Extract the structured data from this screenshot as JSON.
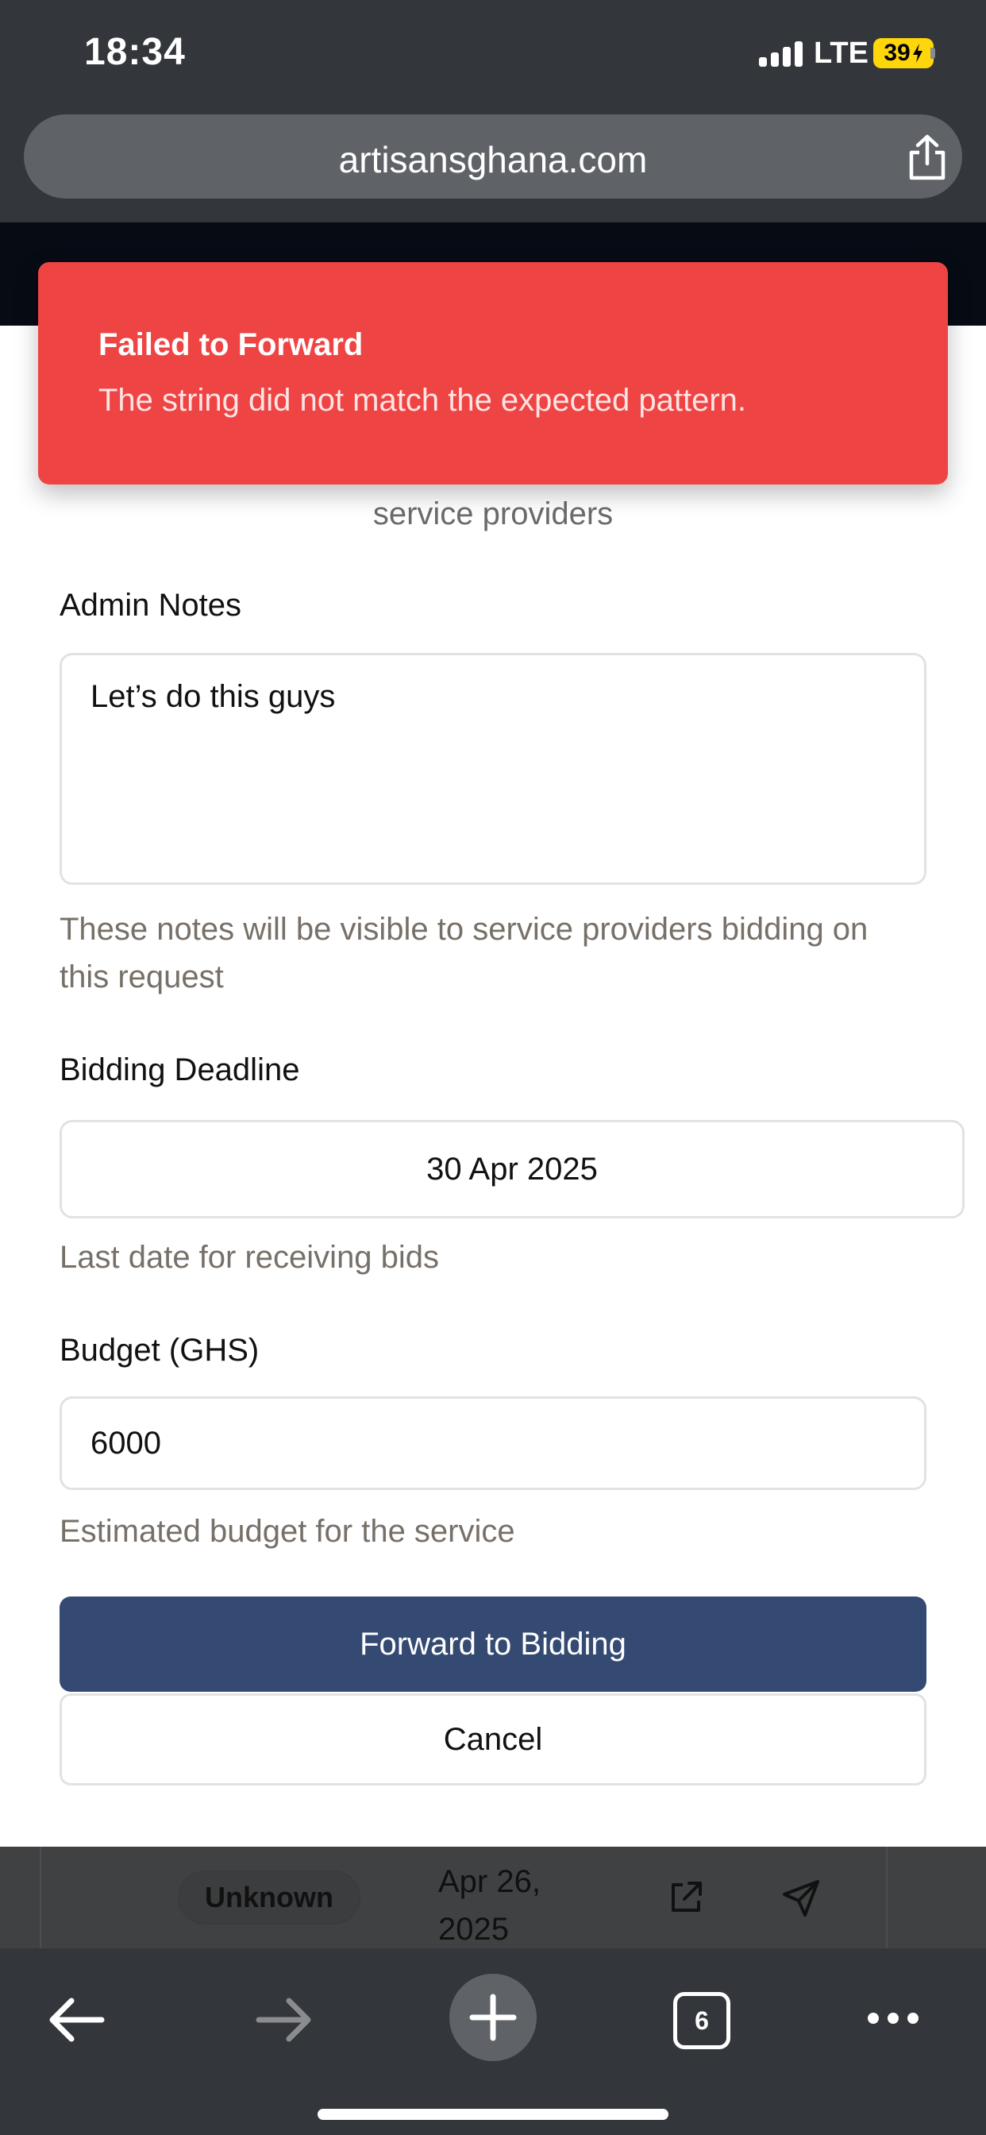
{
  "status_bar": {
    "time": "18:34",
    "network": "LTE",
    "battery": "39"
  },
  "browser": {
    "url": "artisansghana.com",
    "tab_count": "6"
  },
  "toast": {
    "title": "Failed to Forward",
    "message": "The string did not match the expected pattern.",
    "color": "#ef4444"
  },
  "form": {
    "subtitle_fragment": "service providers",
    "admin_notes": {
      "label": "Admin Notes",
      "value": "Let’s do this guys",
      "help": "These notes will be visible to service providers bidding on this request"
    },
    "bidding_deadline": {
      "label": "Bidding Deadline",
      "value": "30 Apr 2025",
      "help": "Last date for receiving bids"
    },
    "budget": {
      "label": "Budget (GHS)",
      "value": "6000",
      "help": "Estimated budget for the service"
    },
    "primary_button": "Forward to Bidding",
    "cancel_button": "Cancel",
    "primary_color": "#354a72"
  },
  "background_row": {
    "status": "Unknown",
    "date": "Apr 26, 2025"
  },
  "icons": [
    "share-icon",
    "external-link-icon",
    "send-icon",
    "back-arrow-icon",
    "forward-arrow-icon",
    "plus-icon",
    "tabs-icon",
    "more-icon"
  ]
}
